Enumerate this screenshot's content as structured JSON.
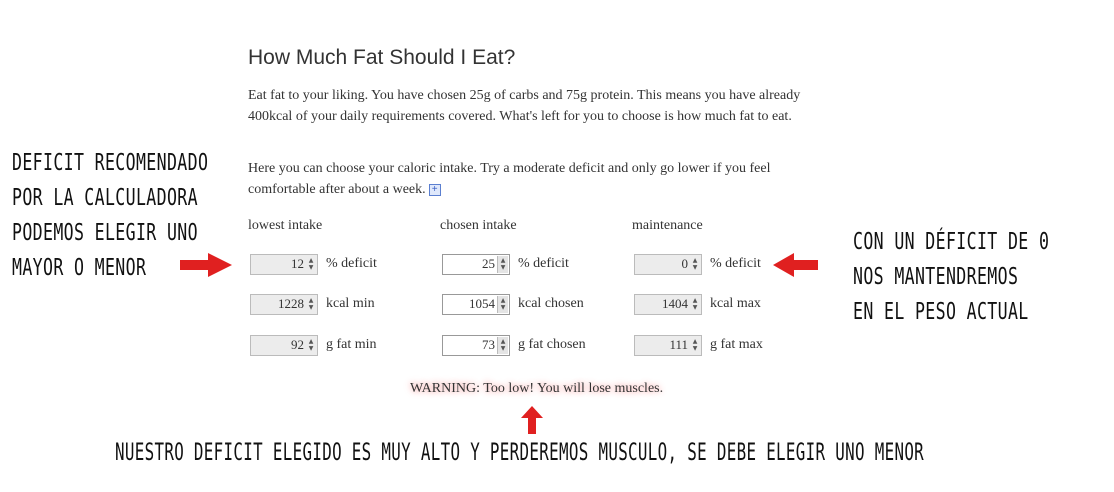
{
  "title": "How Much Fat Should I Eat?",
  "paragraph1": "Eat fat to your liking. You have chosen 25g of carbs and 75g protein. This means you have already 400kcal of your daily requirements covered. What's left for you to choose is how much fat to eat.",
  "paragraph2": "Here you can choose your caloric intake. Try a moderate deficit and only go lower if you feel comfortable after about a week.",
  "info_icon": "+",
  "columns": [
    {
      "heading": "lowest intake",
      "rows": [
        {
          "value": "12",
          "label": "% deficit"
        },
        {
          "value": "1228",
          "label": "kcal min"
        },
        {
          "value": "92",
          "label": "g fat min"
        }
      ]
    },
    {
      "heading": "chosen intake",
      "rows": [
        {
          "value": "25",
          "label": "% deficit"
        },
        {
          "value": "1054",
          "label": "kcal chosen"
        },
        {
          "value": "73",
          "label": "g fat chosen"
        }
      ]
    },
    {
      "heading": "maintenance",
      "rows": [
        {
          "value": "0",
          "label": "% deficit"
        },
        {
          "value": "1404",
          "label": "kcal max"
        },
        {
          "value": "111",
          "label": "g fat max"
        }
      ]
    }
  ],
  "warning": "WARNING: Too low! You will lose muscles.",
  "annotations": {
    "left": [
      "DEFICIT RECOMENDADO",
      "POR LA CALCULADORA",
      "PODEMOS ELEGIR UNO",
      "MAYOR O MENOR"
    ],
    "right": [
      "CON UN DÉFICIT DE 0",
      "NOS MANTENDREMOS",
      "EN EL PESO ACTUAL"
    ],
    "bottom": "NUESTRO DEFICIT ELEGIDO ES MUY ALTO Y PERDEREMOS MUSCULO, SE DEBE ELEGIR UNO MENOR"
  },
  "colors": {
    "arrow": "#e02020",
    "warning_glow": "#f3a0a0"
  }
}
